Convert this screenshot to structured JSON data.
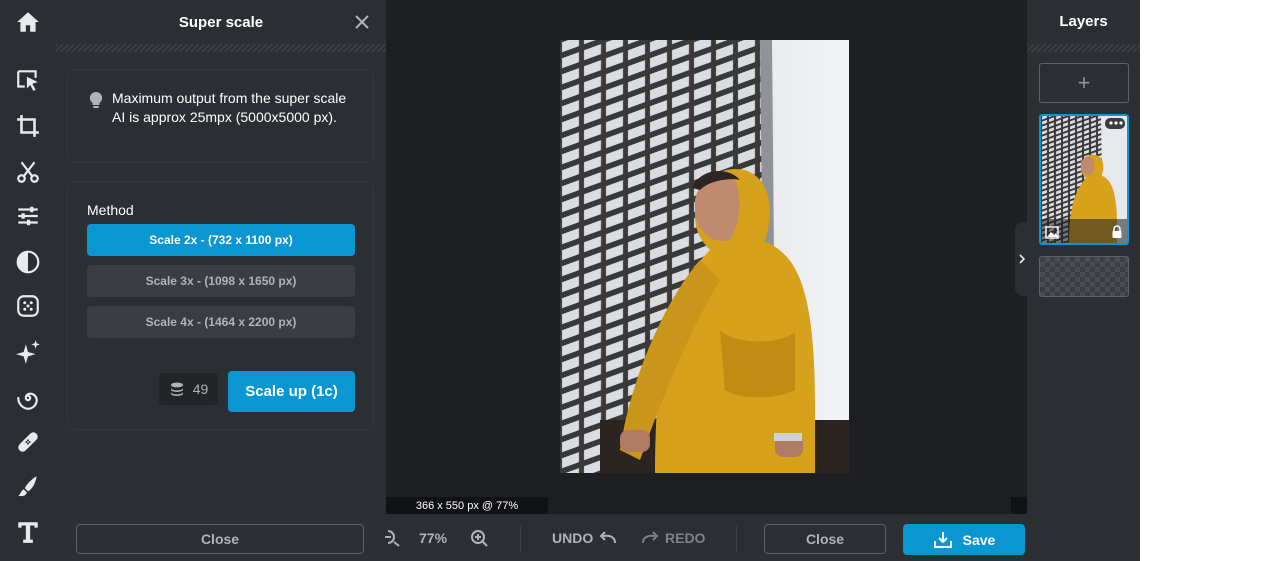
{
  "toolbar": {
    "items": [
      {
        "name": "home-icon"
      },
      {
        "name": "arrange-icon"
      },
      {
        "name": "crop-icon"
      },
      {
        "name": "cutout-icon"
      },
      {
        "name": "adjust-icon"
      },
      {
        "name": "filter-icon"
      },
      {
        "name": "effects-icon"
      },
      {
        "name": "ai-tools-icon"
      },
      {
        "name": "liquify-icon"
      },
      {
        "name": "retouch-icon"
      },
      {
        "name": "draw-icon"
      },
      {
        "name": "text-icon"
      }
    ]
  },
  "panel": {
    "title": "Super scale",
    "info": "Maximum output from the super scale AI is approx 25mpx (5000x5000 px).",
    "method_label": "Method",
    "options": [
      {
        "label": "Scale 2x - (732 x 1100 px)",
        "selected": true
      },
      {
        "label": "Scale 3x - (1098 x 1650 px)",
        "selected": false
      },
      {
        "label": "Scale 4x - (1464 x 2200 px)",
        "selected": false
      }
    ],
    "credits": "49",
    "scale_up_label": "Scale up (1c)",
    "close_label": "Close"
  },
  "canvas": {
    "dimensions_label": "366 x 550 px @ 77%"
  },
  "bottom_bar": {
    "zoom": "77%",
    "undo_label": "UNDO",
    "redo_label": "REDO",
    "close_label": "Close",
    "save_label": "Save"
  },
  "layers": {
    "title": "Layers",
    "add_label": "+"
  },
  "colors": {
    "accent": "#0a96d1",
    "panel_bg": "#2b2e33",
    "canvas_bg": "#1e1f22"
  }
}
